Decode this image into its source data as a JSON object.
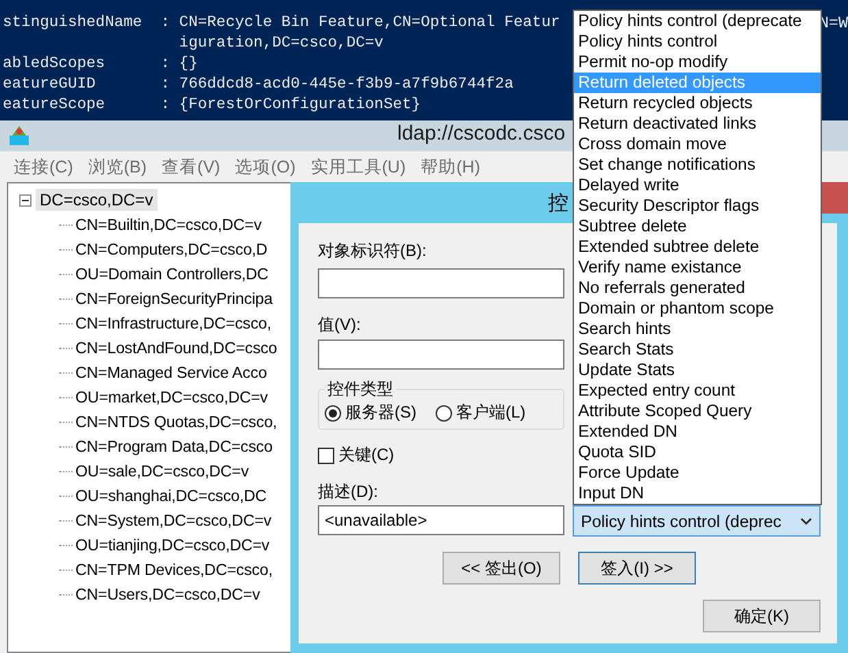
{
  "terminal": {
    "lines": [
      "stinguishedName  : CN=Recycle Bin Feature,CN=Optional Featur",
      "                   iguration,DC=csco,DC=v",
      "abledScopes      : {}",
      "eatureGUID       : 766ddcd8-acd0-445e-f3b9-a7f9b6744f2a",
      "eatureScope      : {ForestOrConfigurationSet}"
    ],
    "tail": "N=W"
  },
  "window": {
    "title": "ldap://cscodc.csco"
  },
  "menu": [
    {
      "label": "连接(C)",
      "disabled": true
    },
    {
      "label": "浏览(B)",
      "disabled": true
    },
    {
      "label": "查看(V)",
      "disabled": true
    },
    {
      "label": "选项(O)",
      "disabled": true
    },
    {
      "label": "实用工具(U)",
      "disabled": true
    },
    {
      "label": "帮助(H)",
      "disabled": true
    }
  ],
  "tree": {
    "label": "DC=csco,DC=v",
    "expanded": true,
    "selected": true,
    "children": [
      {
        "label": "CN=Builtin,DC=csco,DC=v"
      },
      {
        "label": "CN=Computers,DC=csco,D"
      },
      {
        "label": "OU=Domain Controllers,DC"
      },
      {
        "label": "CN=ForeignSecurityPrincipa"
      },
      {
        "label": "CN=Infrastructure,DC=csco,"
      },
      {
        "label": "CN=LostAndFound,DC=csco"
      },
      {
        "label": "CN=Managed Service Acco"
      },
      {
        "label": "OU=market,DC=csco,DC=v"
      },
      {
        "label": "CN=NTDS Quotas,DC=csco,"
      },
      {
        "label": "CN=Program Data,DC=csco"
      },
      {
        "label": "OU=sale,DC=csco,DC=v"
      },
      {
        "label": "OU=shanghai,DC=csco,DC"
      },
      {
        "label": "CN=System,DC=csco,DC=v"
      },
      {
        "label": "OU=tianjing,DC=csco,DC=v"
      },
      {
        "label": "CN=TPM Devices,DC=csco,"
      },
      {
        "label": "CN=Users,DC=csco,DC=v"
      }
    ]
  },
  "dialog": {
    "title": "控",
    "object_id": {
      "label": "对象标识符(B):"
    },
    "value": {
      "label": "值(V):"
    },
    "control_type": {
      "legend": "控件类型",
      "options": [
        {
          "label": "服务器(S)",
          "selected": true
        },
        {
          "label": "客户端(L)",
          "selected": false
        }
      ]
    },
    "critical": {
      "label": "关键(C)",
      "checked": false
    },
    "description": {
      "label": "描述(D):",
      "value": "<unavailable>"
    },
    "combo": {
      "value": "Policy hints control (deprec",
      "open": true,
      "items": [
        {
          "label": "Policy hints control (deprecate",
          "selected": false
        },
        {
          "label": "Policy hints control",
          "selected": false
        },
        {
          "label": "Permit no-op modify",
          "selected": false
        },
        {
          "label": "Return deleted objects",
          "selected": true
        },
        {
          "label": "Return recycled objects",
          "selected": false
        },
        {
          "label": "Return deactivated links",
          "selected": false
        },
        {
          "label": "Cross domain move",
          "selected": false
        },
        {
          "label": "Set change notifications",
          "selected": false
        },
        {
          "label": "Delayed write",
          "selected": false
        },
        {
          "label": "Security Descriptor flags",
          "selected": false
        },
        {
          "label": "Subtree delete",
          "selected": false
        },
        {
          "label": "Extended subtree delete",
          "selected": false
        },
        {
          "label": "Verify name existance",
          "selected": false
        },
        {
          "label": "No referrals generated",
          "selected": false
        },
        {
          "label": "Domain or phantom scope",
          "selected": false
        },
        {
          "label": "Search hints",
          "selected": false
        },
        {
          "label": "Search Stats",
          "selected": false
        },
        {
          "label": "Update Stats",
          "selected": false
        },
        {
          "label": "Expected entry count",
          "selected": false
        },
        {
          "label": "Attribute Scoped Query",
          "selected": false
        },
        {
          "label": "Extended DN",
          "selected": false
        },
        {
          "label": "Quota SID",
          "selected": false
        },
        {
          "label": "Force Update",
          "selected": false
        },
        {
          "label": "Input DN",
          "selected": false
        }
      ]
    },
    "buttons": [
      {
        "label": "<< 签出(O)"
      },
      {
        "label": "签入(I) >>"
      }
    ],
    "ok_button": {
      "label": "确定(K)"
    }
  }
}
